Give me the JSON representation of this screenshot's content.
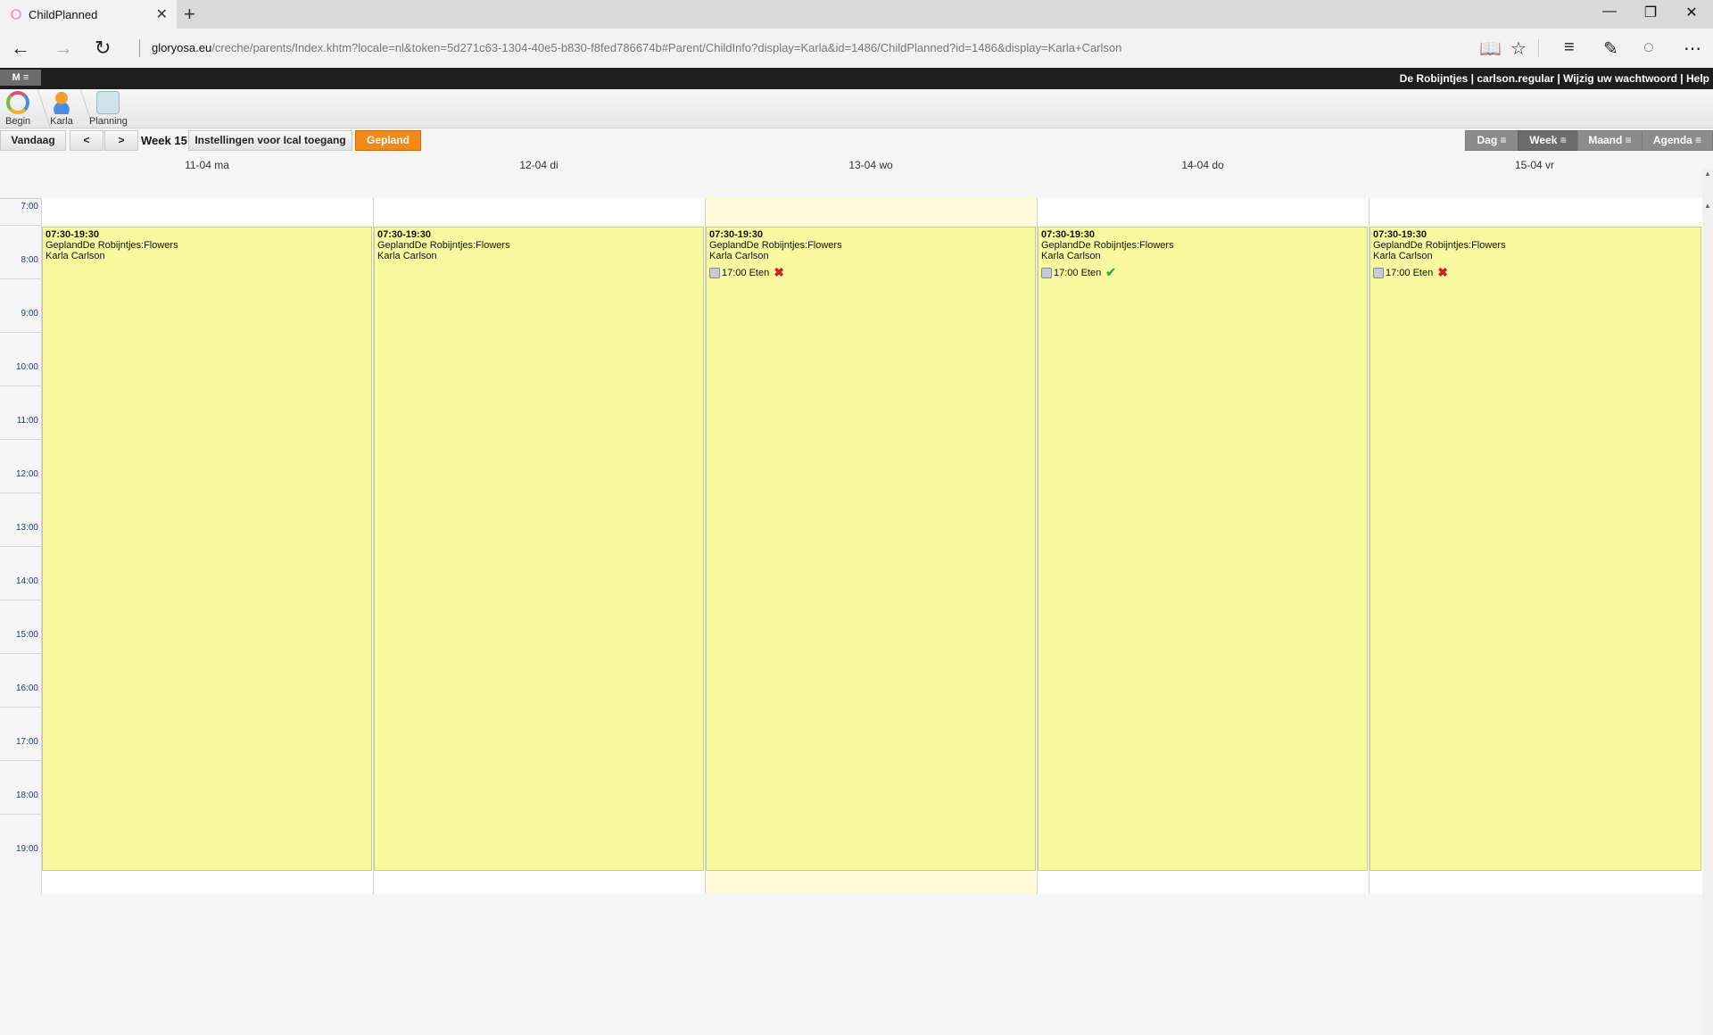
{
  "browser": {
    "tab_title": "ChildPlanned",
    "url_host": "gloryosa.eu",
    "url_path": "/creche/parents/Index.khtm?locale=nl&token=5d271c63-1304-40e5-b830-f8fed786674b#Parent/ChildInfo?display=Karla&id=1486/ChildPlanned?id=1486&display=Karla+Carlson"
  },
  "app": {
    "menu_label": "M ≡",
    "user_links": "De Robijntjes | carlson.regular | Wijzig uw wachtwoord | Help"
  },
  "breadcrumbs": [
    {
      "label": "Begin"
    },
    {
      "label": "Karla"
    },
    {
      "label": "Planning"
    }
  ],
  "toolbar": {
    "today": "Vandaag",
    "prev": "<",
    "next": ">",
    "week": "Week 15",
    "ical": "Instellingen voor Ical toegang",
    "planned": "Gepland",
    "views": [
      "Dag ≡",
      "Week ≡",
      "Maand ≡",
      "Agenda ≡"
    ]
  },
  "calendar": {
    "days": [
      "11-04 ma",
      "12-04 di",
      "13-04 wo",
      "14-04 do",
      "15-04 vr"
    ],
    "hours": [
      "7:00",
      "8:00",
      "9:00",
      "10:00",
      "11:00",
      "12:00",
      "13:00",
      "14:00",
      "15:00",
      "16:00",
      "17:00",
      "18:00",
      "19:00"
    ],
    "events": [
      {
        "time": "07:30-19:30",
        "group": "GeplandDe Robijntjes:Flowers",
        "child": "Karla Carlson",
        "meal": "",
        "meal_status": ""
      },
      {
        "time": "07:30-19:30",
        "group": "GeplandDe Robijntjes:Flowers",
        "child": "Karla Carlson",
        "meal": "",
        "meal_status": ""
      },
      {
        "time": "07:30-19:30",
        "group": "GeplandDe Robijntjes:Flowers",
        "child": "Karla Carlson",
        "meal": "17:00 Eten",
        "meal_status": "✖"
      },
      {
        "time": "07:30-19:30",
        "group": "GeplandDe Robijntjes:Flowers",
        "child": "Karla Carlson",
        "meal": "17:00 Eten",
        "meal_status": "✔"
      },
      {
        "time": "07:30-19:30",
        "group": "GeplandDe Robijntjes:Flowers",
        "child": "Karla Carlson",
        "meal": "17:00 Eten",
        "meal_status": "✖"
      }
    ]
  },
  "colors": {
    "event_bg": "#f9f9a0",
    "planned_btn": "#f08a1a",
    "today_col": "#fffbd8"
  }
}
